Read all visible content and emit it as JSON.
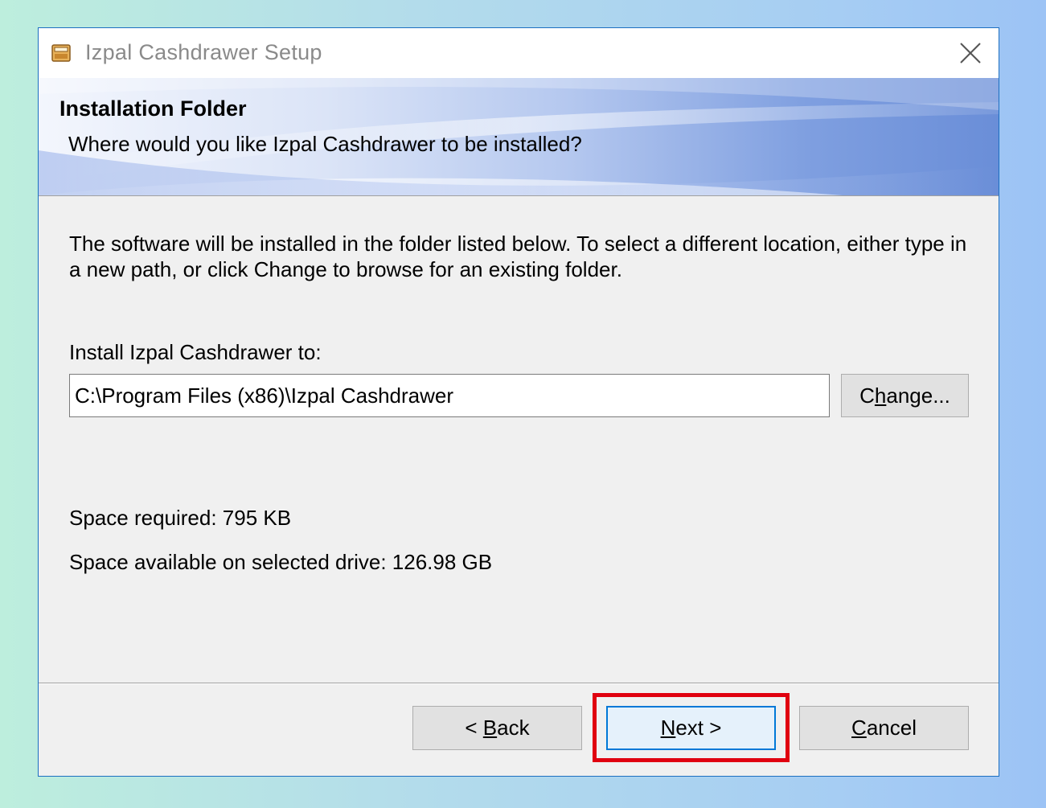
{
  "window": {
    "title": "Izpal Cashdrawer Setup",
    "icon": "installer-app-icon",
    "close_icon": "close-x-icon"
  },
  "banner": {
    "title": "Installation Folder",
    "subtitle": "Where would you like Izpal Cashdrawer to be installed?"
  },
  "body": {
    "description": "The software will be installed in the folder listed below. To select a different location, either type in a new path, or click Change to browse for an existing folder.",
    "install_label": "Install Izpal Cashdrawer to:",
    "install_path": "C:\\Program Files (x86)\\Izpal Cashdrawer",
    "change_button": {
      "pre": "C",
      "accel": "h",
      "post": "ange..."
    },
    "space_required": "Space required: 795 KB",
    "space_available": "Space available on selected drive: 126.98 GB"
  },
  "footer": {
    "back_button": {
      "pre": "< ",
      "accel": "B",
      "post": "ack"
    },
    "next_button": {
      "pre": "",
      "accel": "N",
      "post": "ext >"
    },
    "cancel_button": {
      "pre": "",
      "accel": "C",
      "post": "ancel"
    }
  },
  "colors": {
    "window_border": "#1c6fc1",
    "focus_border": "#0078d7",
    "highlight_box": "#e0000f",
    "dialog_bg": "#f0f0f0"
  }
}
